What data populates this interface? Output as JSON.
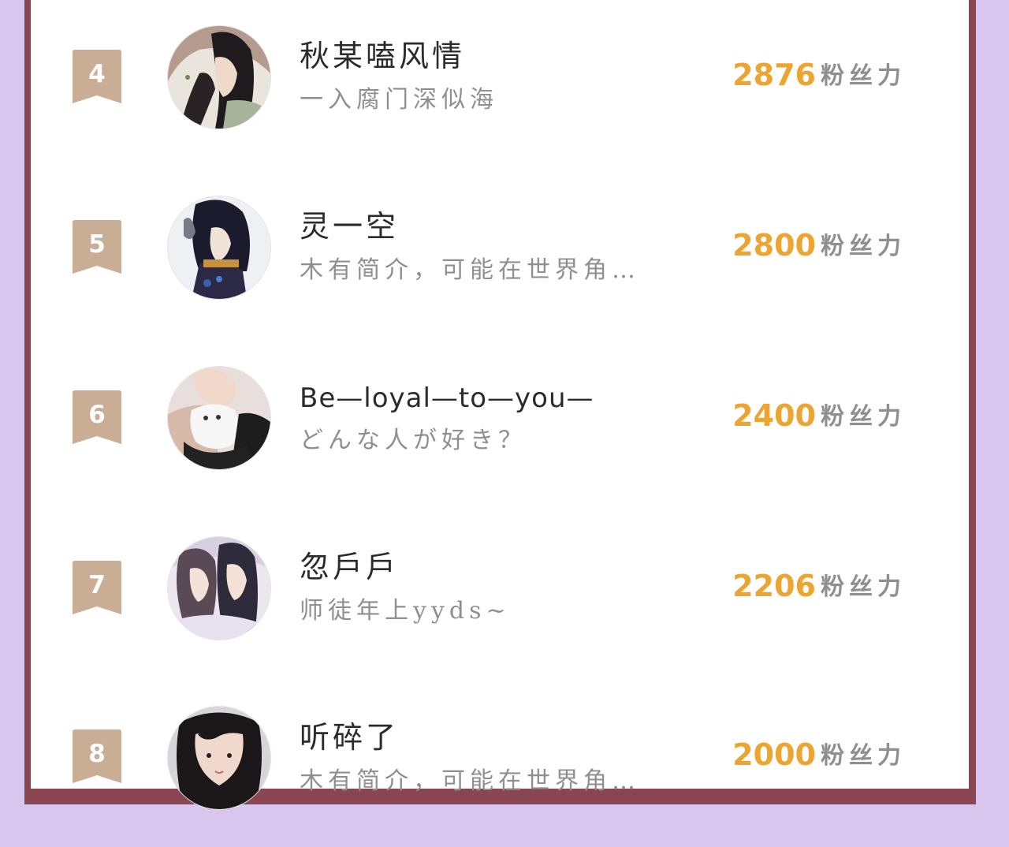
{
  "ranking": {
    "entries": [
      {
        "rank": "4",
        "name": "秋某嗑风情",
        "bio": "一入腐门深似海",
        "score": "2876",
        "unit": "粉丝力"
      },
      {
        "rank": "5",
        "name": "灵一空",
        "bio": "木有简介，可能在世界角…",
        "score": "2800",
        "unit": "粉丝力"
      },
      {
        "rank": "6",
        "name": "Be—loyal—to—you—",
        "bio": "どんな人が好き？",
        "score": "2400",
        "unit": "粉丝力"
      },
      {
        "rank": "7",
        "name": "忽戶戶",
        "bio": "师徒年上yyds~",
        "score": "2206",
        "unit": "粉丝力"
      },
      {
        "rank": "8",
        "name": "听碎了",
        "bio": "木有简介，可能在世界角…",
        "score": "2000",
        "unit": "粉丝力"
      }
    ]
  },
  "colors": {
    "background": "#d9c6ee",
    "frame": "#8a4650",
    "badge": "#c9ad95",
    "score": "#eda532",
    "bio": "#8f8f8f",
    "name": "#2b2b2b"
  },
  "icons": {
    "rank_badge": "ribbon-badge",
    "avatar": "user-avatar"
  }
}
